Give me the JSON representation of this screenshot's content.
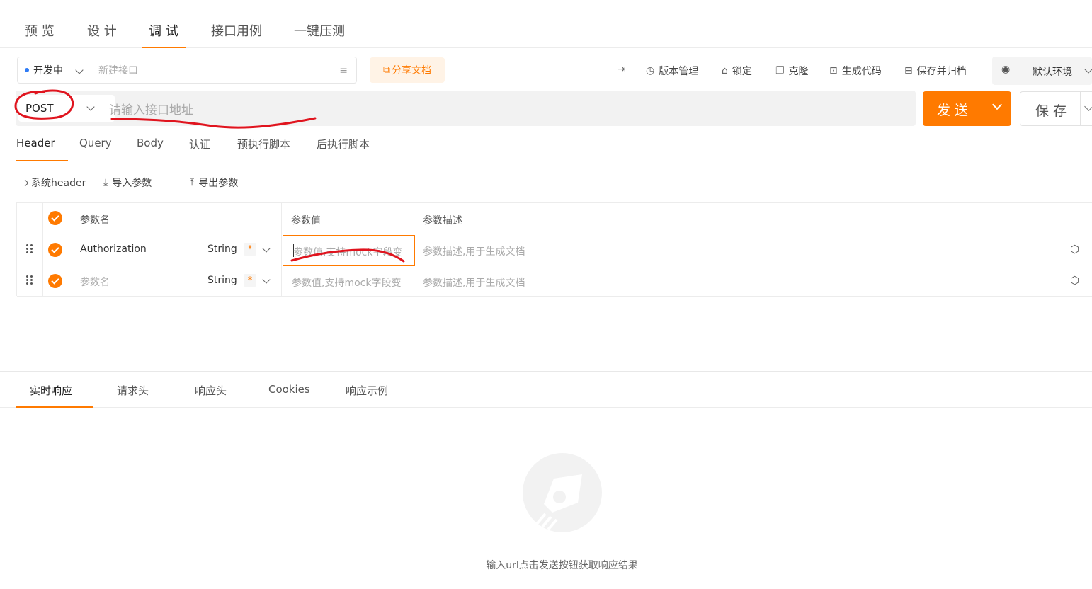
{
  "top_tabs": [
    {
      "label": "预 览"
    },
    {
      "label": "设 计"
    },
    {
      "label": "调 试"
    },
    {
      "label": "接口用例"
    },
    {
      "label": "一键压测"
    }
  ],
  "toolbar": {
    "status": "开发中",
    "name_placeholder": "新建接口",
    "share_label": "分享文档",
    "version_label": "版本管理",
    "lock_label": "锁定",
    "clone_label": "克隆",
    "gen_code_label": "生成代码",
    "save_archive_label": "保存并归档",
    "env_label": "默认环境"
  },
  "request": {
    "method": "POST",
    "url_placeholder": "请输入接口地址",
    "send_label": "发 送",
    "save_label": "保 存"
  },
  "req_tabs": [
    {
      "label": "Header"
    },
    {
      "label": "Query"
    },
    {
      "label": "Body"
    },
    {
      "label": "认证"
    },
    {
      "label": "预执行脚本"
    },
    {
      "label": "后执行脚本"
    }
  ],
  "param_tools": {
    "system_header": "系统header",
    "import_label": "导入参数",
    "export_label": "导出参数"
  },
  "param_table": {
    "headers": {
      "name": "参数名",
      "value": "参数值",
      "desc": "参数描述"
    },
    "rows": [
      {
        "name": "Authorization",
        "type": "String",
        "required": "*",
        "value_placeholder": "参数值,支持mock字段变",
        "desc_placeholder": "参数描述,用于生成文档"
      },
      {
        "name": "参数名",
        "type": "String",
        "required": "*",
        "value_placeholder": "参数值,支持mock字段变",
        "desc_placeholder": "参数描述,用于生成文档"
      }
    ]
  },
  "resp_tabs": [
    {
      "label": "实时响应"
    },
    {
      "label": "请求头"
    },
    {
      "label": "响应头"
    },
    {
      "label": "Cookies"
    },
    {
      "label": "响应示例"
    }
  ],
  "empty_hint": "输入url点击发送按钮获取响应结果",
  "colors": {
    "accent": "#ff7a00",
    "status_dot": "#2f7cf6",
    "annotation": "#e0141e"
  }
}
